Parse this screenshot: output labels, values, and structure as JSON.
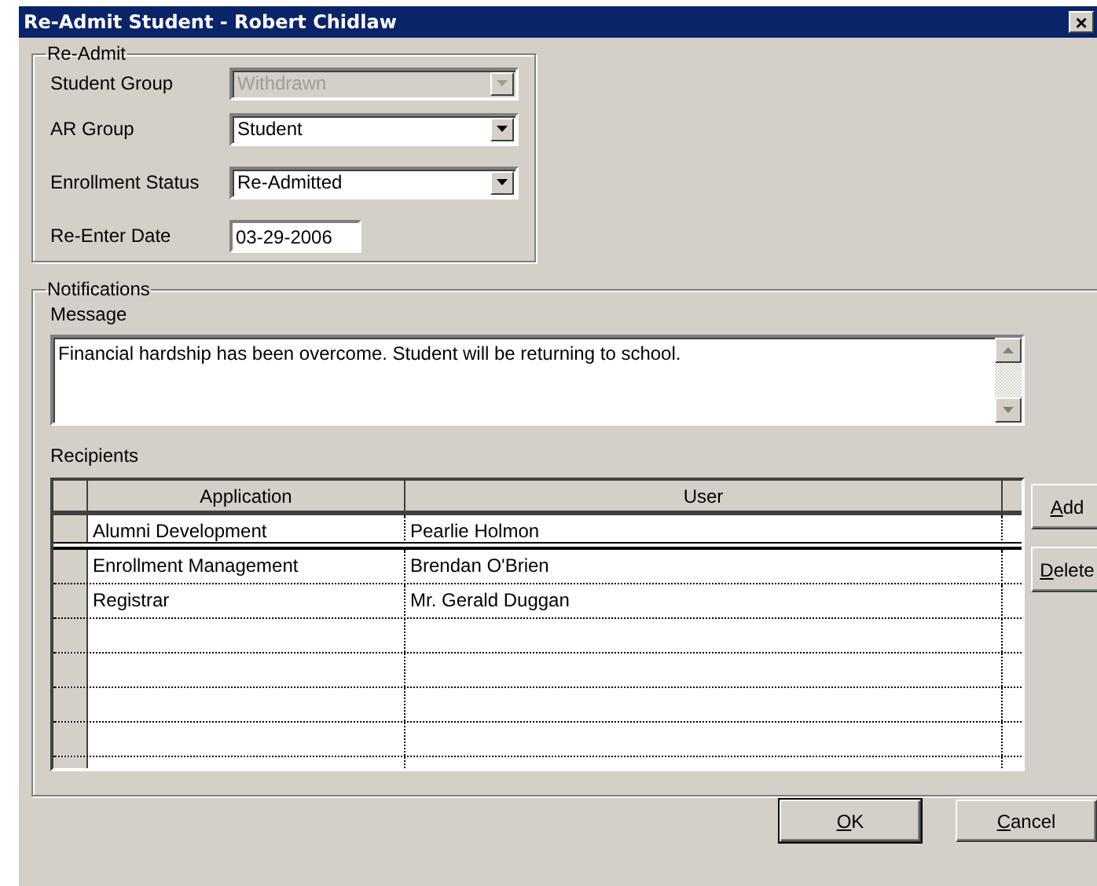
{
  "window": {
    "title": "Re-Admit Student - Robert Chidlaw",
    "close": "×"
  },
  "readmit": {
    "legend": "Re-Admit",
    "fields": [
      {
        "kind": "combo",
        "label": "Student Group",
        "value": "Withdrawn",
        "disabled": true
      },
      {
        "kind": "combo",
        "label": "AR Group",
        "value": "Student",
        "disabled": false
      },
      {
        "kind": "combo",
        "label": "Enrollment Status",
        "value": "Re-Admitted",
        "disabled": false
      },
      {
        "kind": "text",
        "label": "Re-Enter Date",
        "value": "03-29-2006",
        "disabled": false
      }
    ]
  },
  "notifications": {
    "legend": "Notifications",
    "message_label": "Message",
    "message": "Financial hardship has been overcome. Student will be returning to school.",
    "recipients_label": "Recipients",
    "table": {
      "columns": [
        "Application",
        "User"
      ],
      "rows": [
        {
          "cells": [
            "Alumni Development",
            "Pearlie Holmon"
          ],
          "selected": true
        },
        {
          "cells": [
            "Enrollment Management",
            "Brendan O'Brien"
          ],
          "selected": false
        },
        {
          "cells": [
            "Registrar",
            "Mr. Gerald Duggan"
          ],
          "selected": false
        }
      ]
    },
    "buttons": [
      {
        "label": "Add"
      },
      {
        "label": "Delete"
      }
    ]
  },
  "footer_buttons": [
    {
      "label": "OK",
      "default": true
    },
    {
      "label": "Cancel",
      "default": false
    }
  ]
}
